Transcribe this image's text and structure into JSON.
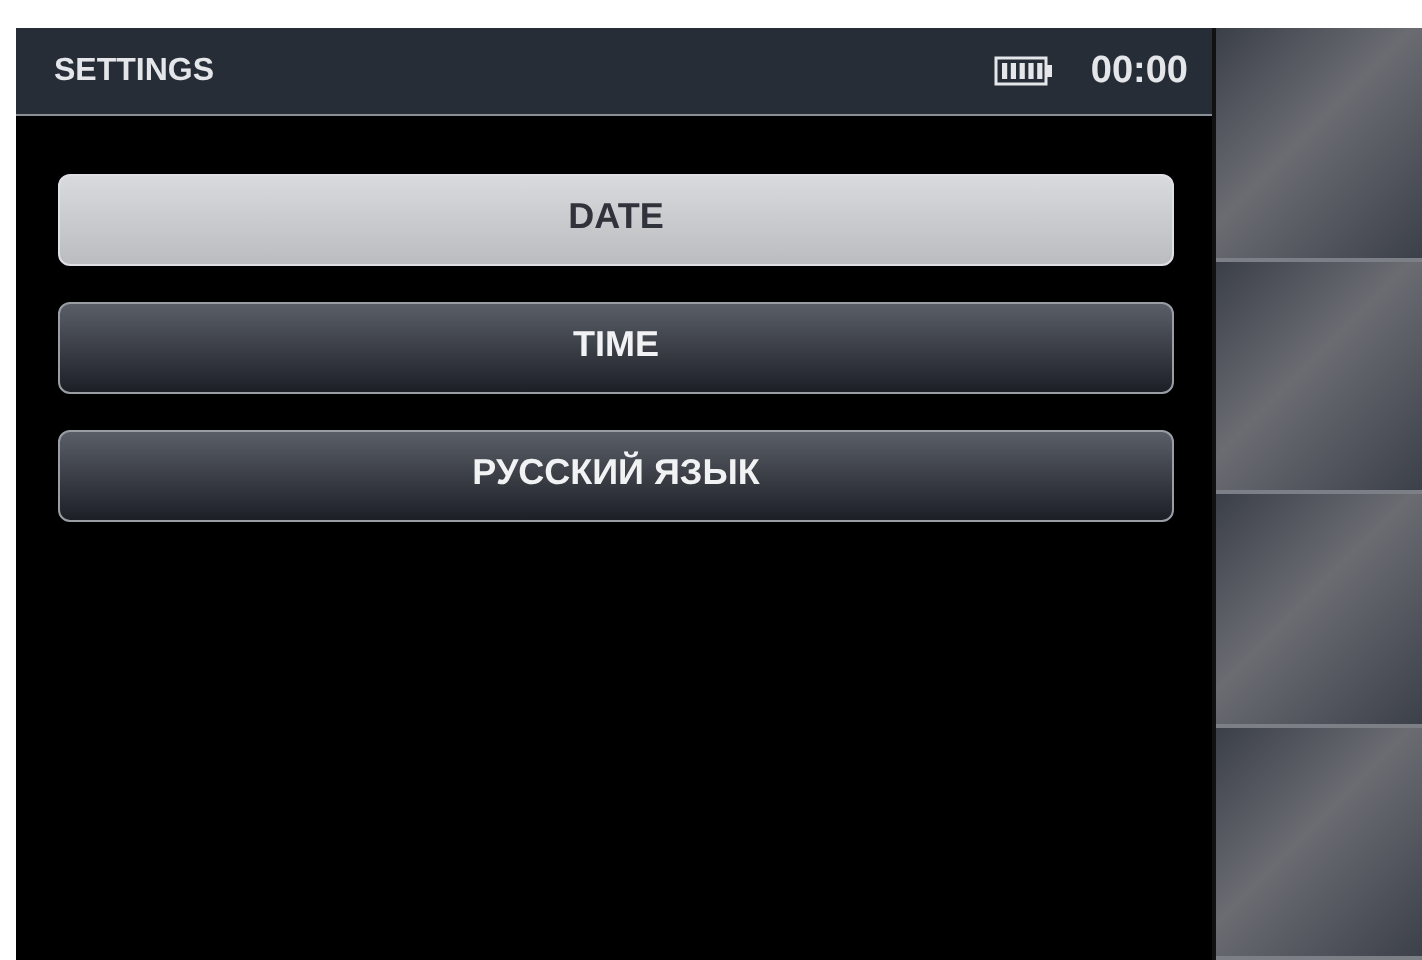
{
  "header": {
    "title": "SETTINGS",
    "time": "00:00"
  },
  "menu": [
    {
      "label": "DATE",
      "selected": true
    },
    {
      "label": "TIME",
      "selected": false
    },
    {
      "label": "РУССКИЙ ЯЗЫК",
      "selected": false
    }
  ]
}
